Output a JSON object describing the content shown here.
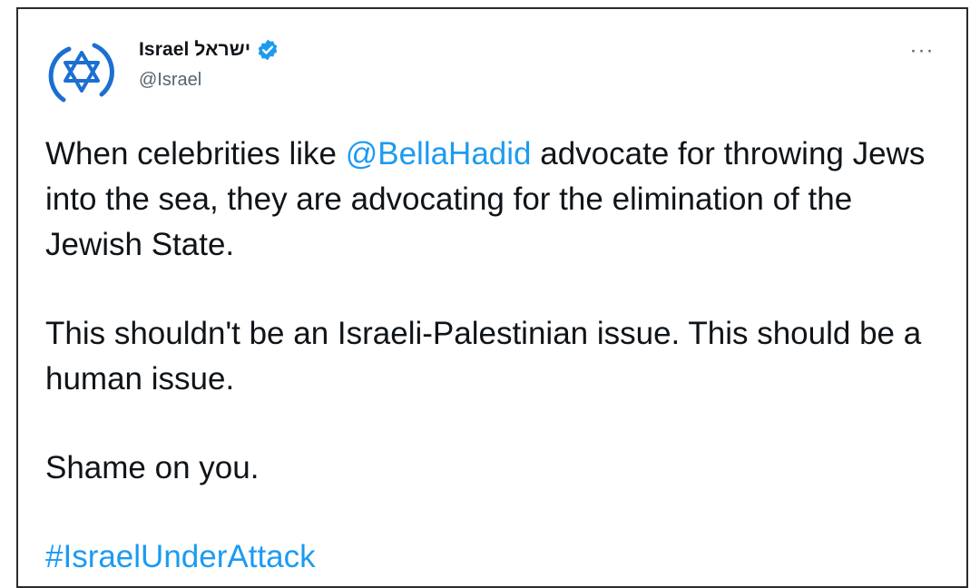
{
  "tweet": {
    "author": {
      "display_name": "Israel ישראל",
      "handle": "@Israel",
      "verified": true,
      "avatar_icon": "star-of-david-icon"
    },
    "more_icon": "more-options-icon",
    "more_label": "···",
    "body": {
      "p1_before": "When celebrities like ",
      "p1_mention": "@BellaHadid",
      "p1_after": " advocate for throwing Jews into the sea, they are advocating for the elimination of the Jewish State.",
      "p2": "This shouldn't be an Israeli-Palestinian issue. This should be a human issue.",
      "p3": "Shame on you.",
      "hashtag": "#IsraelUnderAttack"
    }
  },
  "colors": {
    "link": "#1d9bf0",
    "text": "#0f1419",
    "secondary": "#536471",
    "avatar_blue": "#1c6fd1"
  }
}
